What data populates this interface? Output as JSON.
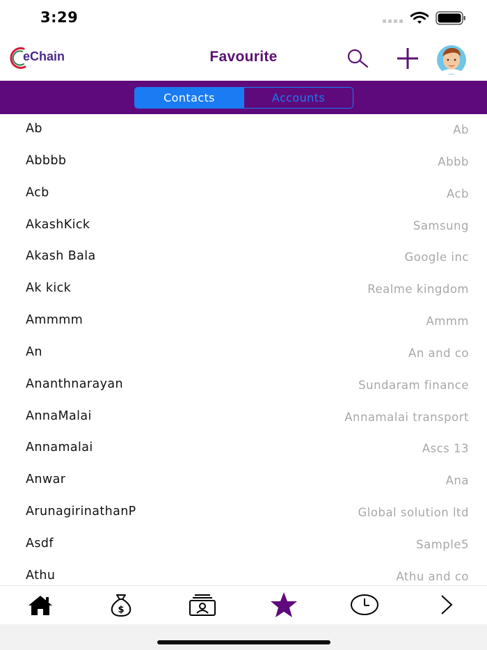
{
  "status_bar": {
    "time": "3:29"
  },
  "header": {
    "logo_text": "eChain",
    "title": "Favourite",
    "search_icon": "search-icon",
    "add_icon": "plus-icon"
  },
  "segments": {
    "contacts": "Contacts",
    "accounts": "Accounts",
    "selected": "Contacts"
  },
  "list": [
    {
      "name": "Ab",
      "account": "Ab"
    },
    {
      "name": "Abbbb",
      "account": "Abbb"
    },
    {
      "name": "Acb",
      "account": "Acb"
    },
    {
      "name": "AkashKick",
      "account": "Samsung"
    },
    {
      "name": "Akash Bala",
      "account": "Google inc"
    },
    {
      "name": "Ak kick",
      "account": "Realme kingdom"
    },
    {
      "name": "Ammmm",
      "account": "Ammm"
    },
    {
      "name": "An",
      "account": "An and co"
    },
    {
      "name": "Ananthnarayan",
      "account": "Sundaram finance"
    },
    {
      "name": "AnnaMalai",
      "account": "Annamalai transport"
    },
    {
      "name": "Annamalai",
      "account": "Ascs 13"
    },
    {
      "name": "Anwar",
      "account": "Ana"
    },
    {
      "name": "ArunagirinathanP",
      "account": "Global solution ltd"
    },
    {
      "name": "Asdf",
      "account": "Sample5"
    },
    {
      "name": "Athu",
      "account": "Athu and co"
    }
  ],
  "tabbar": {
    "tabs": [
      "home-icon",
      "money-bag-icon",
      "contact-card-icon",
      "star-icon",
      "clock-icon",
      "chevron-right-icon"
    ],
    "active": "star-icon"
  },
  "colors": {
    "brand_purple": "#5f0a7c",
    "title_purple": "#5b1173",
    "accent_blue": "#1a7bf2",
    "secondary_text": "#a8a8a8"
  }
}
